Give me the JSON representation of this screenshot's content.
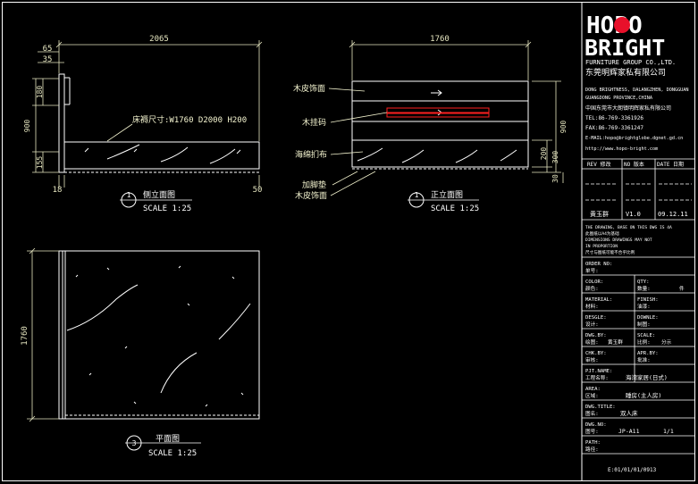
{
  "colors": {
    "background": "#000000",
    "line": "#ffffff",
    "dimension": "#e6e6c0",
    "accent_red": "#ff2020",
    "logo_dot": "#e8102a",
    "text_yellow": "#f5f5d0"
  },
  "logo": {
    "line1": "HOPO",
    "line2": "BRIGHT",
    "company_en": "FURNITURE GROUP CO.,LTD.",
    "company_cn": "东莞明辉家私有限公司"
  },
  "address": [
    "DONG BRIGHTNESS, DALANGZHEN, DONGGUAN",
    "GUANGDONG PROVINCE,CHINA",
    "中国东莞市大朗镇明辉家私有限公司",
    "TEL:86-769-3361926",
    "FAX:86-769-3361247",
    "E-MAIL:hopo@brightglobe.dgnet.gd.cn",
    "http://www.hopo-bright.com"
  ],
  "revision_header": {
    "rev": "REV 修改",
    "no": "NO 版本",
    "date": "DATE 日期"
  },
  "designer_row": {
    "name": "黄玉群",
    "version": "V1.0",
    "date": "09.12.11"
  },
  "notes": [
    "THE DRAWING, BASE ON THIS DWG IS 4A",
    "此图纸以A4为基础",
    "DIMENSIONS DRAWINGS MAY NOT",
    "IN PROPORTION",
    "尺寸与图纸可能不合乎比例"
  ],
  "fields": [
    {
      "label": "ORDER NO:",
      "label_cn": "单号:",
      "value": ""
    },
    {
      "label": "COLOR:",
      "label_cn": "颜色:",
      "value": "",
      "label2": "QTY:",
      "label2_cn": "数量:",
      "value2": "件"
    },
    {
      "label": "MATERIAL:",
      "label_cn": "材料:",
      "value": "",
      "label2": "FINISH:",
      "label2_cn": "油漆:",
      "value2": ""
    },
    {
      "label": "DESGLE:",
      "label_cn": "设计:",
      "value": "",
      "label2": "DOWNLE:",
      "label2_cn": "制图:",
      "value2": ""
    },
    {
      "label": "DWG.BY:",
      "label_cn": "绘图:",
      "value": "黄玉群",
      "label2": "SCALE:",
      "label2_cn": "比例:",
      "value2": "分示"
    },
    {
      "label": "CHK.BY:",
      "label_cn": "审核:",
      "value": "",
      "label2": "APR.BY:",
      "label2_cn": "批准:",
      "value2": ""
    },
    {
      "label": "PJT.NAME:",
      "label_cn": "工程名称:",
      "value": "海湾家居(日式)"
    },
    {
      "label": "AREA:",
      "label_cn": "区域:",
      "value": "睡房(主人房)"
    },
    {
      "label": "DWG.TITLE:",
      "label_cn": "图名:",
      "value": "双人床"
    },
    {
      "label": "DWG.NO:",
      "label_cn": "图号:",
      "value": "JP-A11",
      "value2": "1/1"
    },
    {
      "label": "PATH:",
      "label_cn": "路径:",
      "value": "E:01/01/01/0913"
    }
  ],
  "side_view": {
    "title": "侧立面图",
    "number": "1",
    "scale": "SCALE 1:25",
    "dims": {
      "width": "2065",
      "top_a": "65",
      "top_b": "35",
      "h1": "180",
      "h2": "900",
      "h3": "155",
      "bottom_a": "18",
      "bottom_b": "50"
    },
    "annotation": "床褥尺寸:W1760 D2000 H200"
  },
  "front_view": {
    "title": "正立面图",
    "number": "1",
    "scale": "SCALE 1:25",
    "dims": {
      "width": "1760",
      "h_total": "900",
      "h_a": "200",
      "h_b": "300",
      "h_c": "30"
    },
    "labels": [
      "木皮饰面",
      "木挂码",
      "海绵扪布",
      "加脚垫",
      "木皮饰面"
    ]
  },
  "plan_view": {
    "title": "平面图",
    "number": "3",
    "scale": "SCALE 1:25",
    "dims": {
      "length": "1760"
    }
  }
}
